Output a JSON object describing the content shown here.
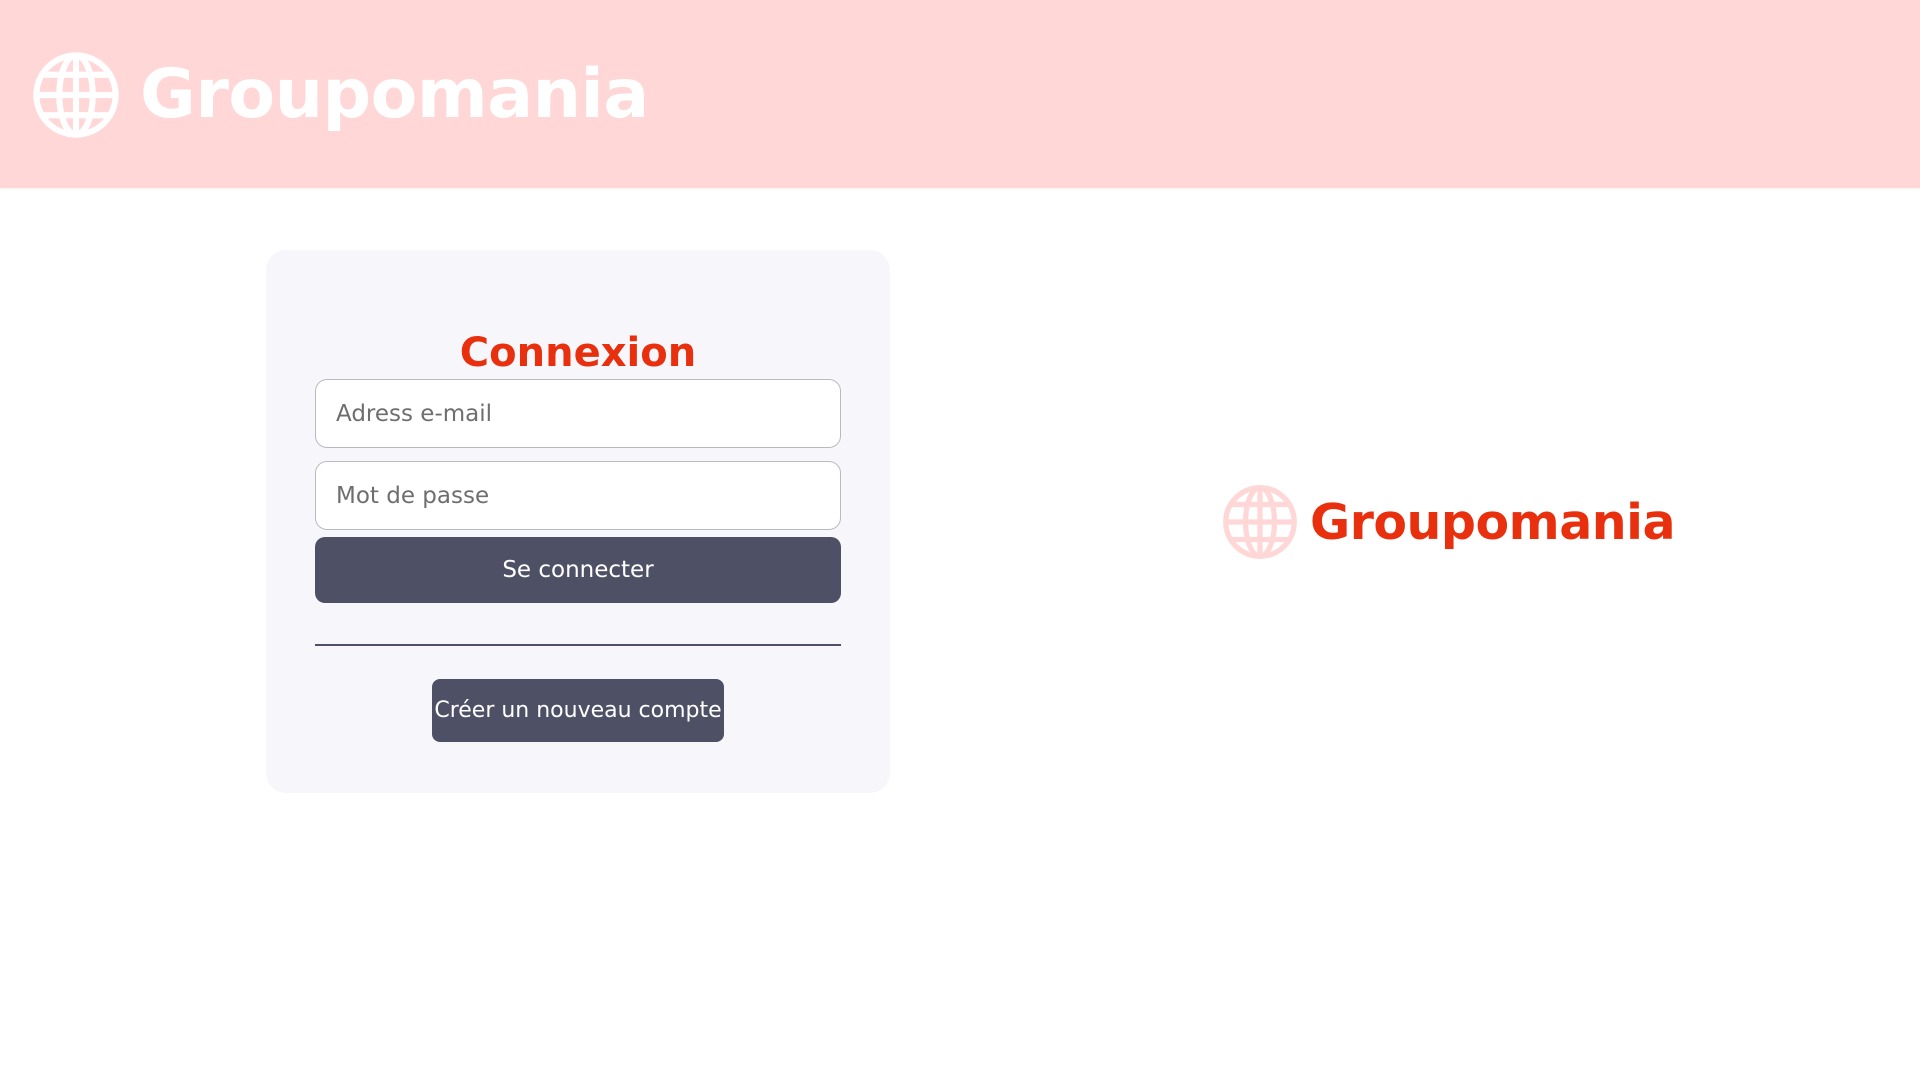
{
  "header": {
    "logo_text": "Groupomania"
  },
  "login": {
    "title": "Connexion",
    "email_placeholder": "Adress e-mail",
    "email_value": "",
    "password_placeholder": "Mot de passe",
    "password_value": "",
    "submit_label": "Se connecter",
    "create_account_label": "Créer un nouveau compte"
  },
  "side": {
    "logo_text": "Groupomania"
  },
  "colors": {
    "header_bg": "#ffd7d7",
    "brand_red": "#e8300e",
    "button_bg": "#4e5166",
    "card_bg": "#f7f7fb",
    "icon_pink": "#ffd7d7"
  },
  "icons": {
    "header_logo": "globe-icon",
    "side_logo": "globe-icon"
  }
}
